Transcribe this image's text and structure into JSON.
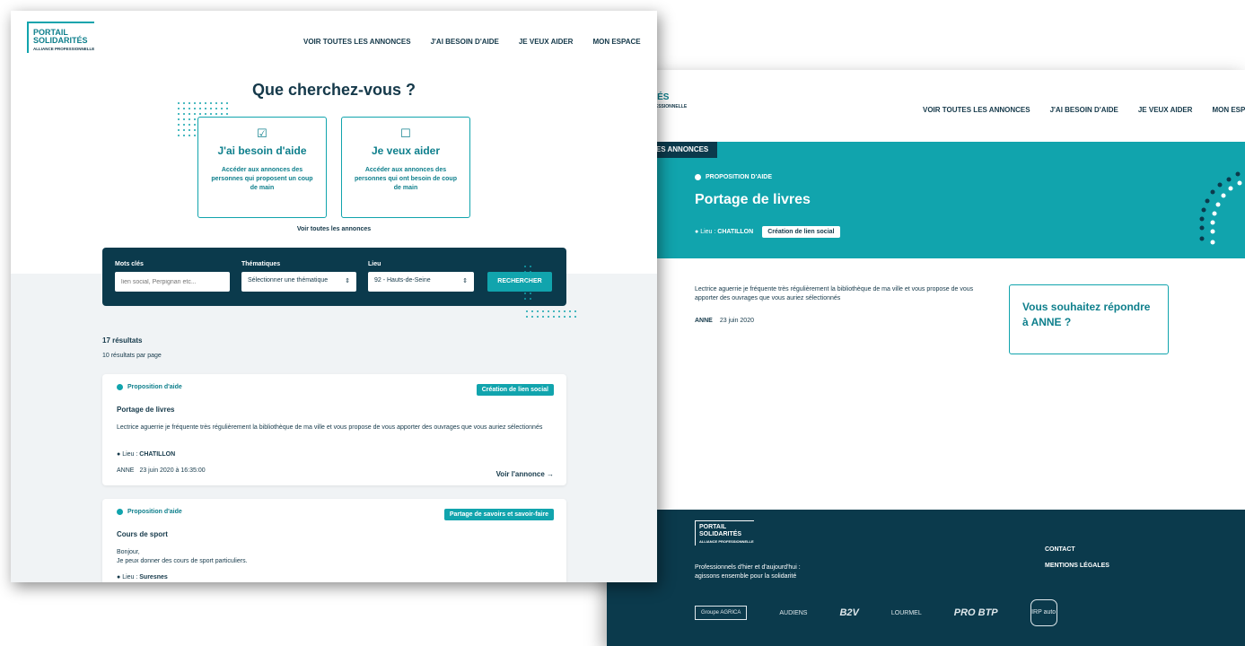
{
  "brand": {
    "line1": "PORTAIL",
    "line2": "SOLIDARITÉS",
    "line3": "ALLIANCE PROFESSIONNELLE"
  },
  "nav": {
    "items": [
      "VOIR TOUTES LES ANNONCES",
      "J'AI BESOIN D'AIDE",
      "JE VEUX AIDER",
      "MON ESPACE"
    ]
  },
  "search_page": {
    "title": "Que cherchez-vous ?",
    "choices": [
      {
        "icon": "checkbox-checked-icon",
        "label": "J'ai besoin d'aide",
        "desc": "Accéder aux annonces des personnes qui proposent un coup de main"
      },
      {
        "icon": "checkbox-empty-icon",
        "label": "Je veux aider",
        "desc": "Accéder aux annonces des personnes qui ont besoin de coup de main"
      }
    ],
    "see_all": "Voir toutes les annonces",
    "search": {
      "keywords_label": "Mots clés",
      "keywords_placeholder": "lien social, Perpignan etc...",
      "theme_label": "Thématiques",
      "theme_value": "Sélectionner une thématique",
      "place_label": "Lieu",
      "place_value": "92 - Hauts-de-Seine",
      "button": "RECHERCHER"
    },
    "results_count": "17 résultats",
    "per_page": "10 résultats par page",
    "results": [
      {
        "type": "Proposition d'aide",
        "tag": "Création de lien social",
        "title": "Portage de livres",
        "desc": "Lectrice aguerrie je fréquente très régulièrement la bibliothèque de ma ville et vous propose de vous apporter des ouvrages que vous auriez sélectionnés",
        "loc_label": "Lieu :",
        "loc_value": "CHATILLON",
        "author": "ANNE",
        "date": "23 juin 2020 à 16:35:00",
        "more": "Voir l'annonce →"
      },
      {
        "type": "Proposition d'aide",
        "tag": "Partage de savoirs et savoir-faire",
        "title": "Cours de sport",
        "desc1": "Bonjour,",
        "desc2": "Je peux donner des cours de sport particuliers.",
        "loc_label": "Lieu :",
        "loc_value": "Suresnes"
      }
    ]
  },
  "detail_page": {
    "breadcrumb": "LES ANNONCES",
    "type": "PROPOSITION D'AIDE",
    "title": "Portage de livres",
    "loc_label": "Lieu :",
    "loc_value": "CHATILLON",
    "tag": "Création de lien social",
    "desc": "Lectrice aguerrie je fréquente très régulièrement la bibliothèque de ma ville et vous propose de vous apporter des ouvrages que vous auriez sélectionnés",
    "author": "ANNE",
    "date": "23 juin 2020",
    "reply": "Vous souhaitez répondre à ANNE ?",
    "brand_line2": "RITÉS",
    "brand_line3": "PROFESSIONNELLE"
  },
  "footer": {
    "tagline1": "Professionnels d'hier et d'aujourd'hui :",
    "tagline2": "agissons ensemble pour la solidarité",
    "links": [
      "CONTACT",
      "MENTIONS LÉGALES"
    ],
    "partners": [
      "Groupe AGRICA",
      "AUDIENS",
      "B2V",
      "LOURMEL",
      "PRO BTP",
      "IRP auto"
    ]
  },
  "colors": {
    "teal": "#11a4ad",
    "navy": "#0b3a4c",
    "text": "#15394a",
    "grey_bg": "#f0f3f5"
  }
}
